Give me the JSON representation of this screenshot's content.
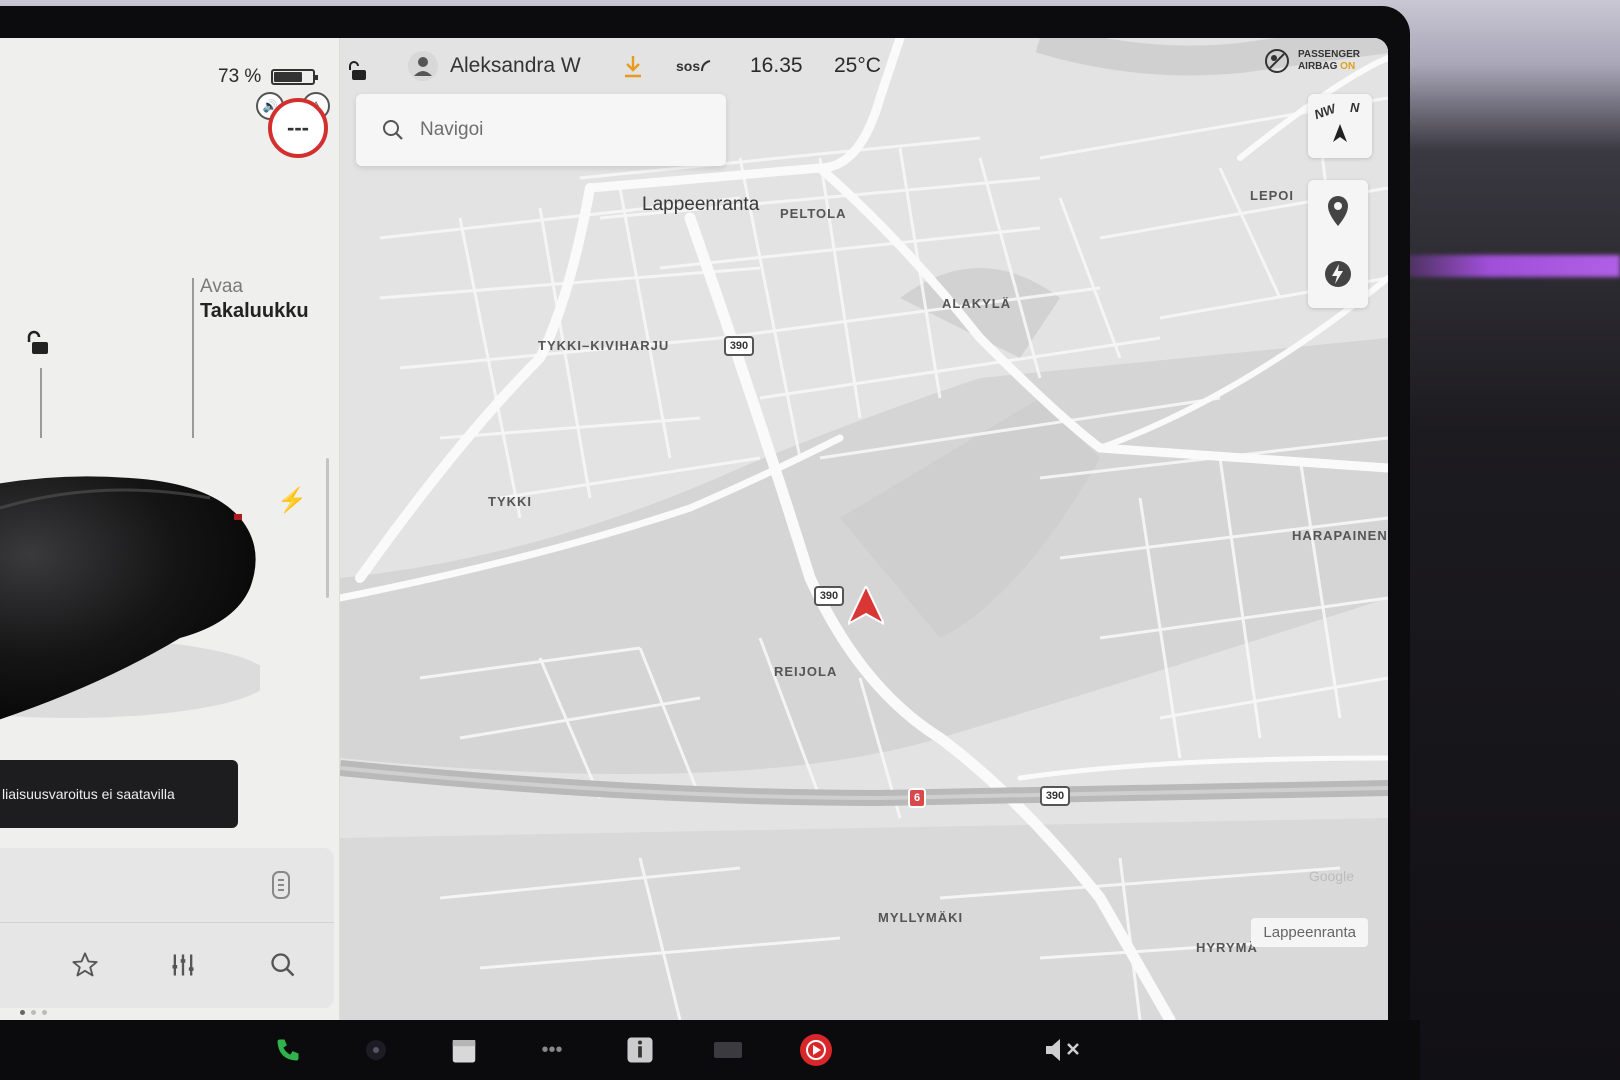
{
  "status_bar": {
    "battery_percent_label": "73 %",
    "battery_level": 0.73,
    "speed_limit_text": "---",
    "driver_name": "Aleksandra W",
    "sos_label": "sos",
    "time": "16.35",
    "temperature": "25°C",
    "airbag_line1": "PASSENGER",
    "airbag_line2": "AIRBAG",
    "airbag_state": "ON"
  },
  "car_panel": {
    "trunk_action": "Avaa",
    "trunk_label": "Takaluukku",
    "toast_text": "liaisuusvaroitus ei saatavilla"
  },
  "search": {
    "placeholder": "Navigoi"
  },
  "map": {
    "city_label": "Lappeenranta",
    "places": {
      "peltola": "PELTOLA",
      "alakyla": "ALAKYLÄ",
      "tykki_kiviharju": "TYKKI–KIVIHARJU",
      "tykki": "TYKKI",
      "lepoi": "LEPOI",
      "harapainen": "HARAPAINEN",
      "reijola": "REIJOLA",
      "myllymaki": "MYLLYMÄKI",
      "hyryma": "HYRYMÄ"
    },
    "road_390": "390",
    "road_6": "6",
    "compass_nw": "NW",
    "compass_n": "N",
    "attribution": "Google",
    "location_chip": "Lappeenranta"
  },
  "colors": {
    "accent_red": "#d93636",
    "airbag_on": "#e0a020",
    "download_orange": "#e89a1c",
    "phone_green": "#2fb34a"
  }
}
